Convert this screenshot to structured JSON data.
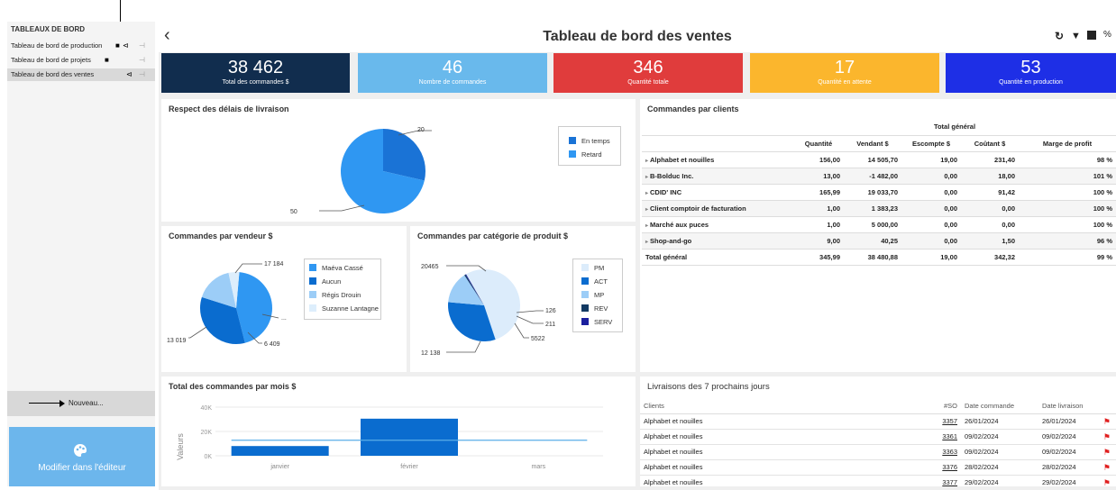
{
  "sidebar": {
    "title": "TABLEAUX DE BORD",
    "items": [
      {
        "label": "Tableau de bord de production"
      },
      {
        "label": "Tableau de bord de projets"
      },
      {
        "label": "Tableau de bord des ventes"
      }
    ],
    "new_label": "Nouveau...",
    "edit_label": "Modifier dans l'éditeur"
  },
  "header": {
    "title": "Tableau de bord des ventes"
  },
  "kpis": [
    {
      "value": "38 462",
      "label": "Total des commandes $",
      "color": "#112d4e"
    },
    {
      "value": "46",
      "label": "Nombre de commandes",
      "color": "#69b9ec"
    },
    {
      "value": "346",
      "label": "Quantité totale",
      "color": "#e03c3c"
    },
    {
      "value": "17",
      "label": "Quantité en attente",
      "color": "#fbb62d"
    },
    {
      "value": "53",
      "label": "Quantité en production",
      "color": "#1e2fe6"
    }
  ],
  "chart_data": [
    {
      "type": "pie",
      "title": "Respect des délais de livraison",
      "categories": [
        "En temps",
        "Retard"
      ],
      "values": [
        20,
        50
      ],
      "colors": [
        "#1a73d6",
        "#2f97f2"
      ],
      "legend": "right"
    },
    {
      "type": "pie",
      "title": "Commandes par vendeur $",
      "categories": [
        "Maéva Cassé",
        "Aucun",
        "Régis Drouin",
        "Suzanne Lantagne"
      ],
      "values": [
        17184,
        13019,
        6409,
        1850
      ],
      "data_labels": [
        "17 184",
        "13 019",
        "6 409",
        "..."
      ],
      "colors": [
        "#2f97f2",
        "#0a6ccf",
        "#9ccdf7",
        "#ddeefc"
      ],
      "legend": "right"
    },
    {
      "type": "pie",
      "title": "Commandes par catégorie de produit $",
      "categories": [
        "PM",
        "ACT",
        "MP",
        "REV",
        "SERV"
      ],
      "values": [
        20465,
        12138,
        5522,
        211,
        126
      ],
      "data_labels": [
        "20465",
        "12 138",
        "5522",
        "211",
        "126"
      ],
      "colors": [
        "#dcecfb",
        "#0a6ccf",
        "#9ccdf7",
        "#123a63",
        "#1b1f9e"
      ],
      "legend": "right"
    },
    {
      "type": "bar",
      "title": "Total des commandes par mois $",
      "categories": [
        "janvier",
        "février",
        "mars"
      ],
      "values": [
        8000,
        30500,
        0
      ],
      "average": 12800,
      "ylabel": "Valeurs",
      "yticks": [
        "40K",
        "20K",
        "0K"
      ],
      "ylim": [
        0,
        40000
      ]
    }
  ],
  "clients_table": {
    "title": "Commandes par clients",
    "group_header": "Total général",
    "columns": [
      "Quantité",
      "Vendant $",
      "Escompte $",
      "Coûtant $",
      "Marge de profit"
    ],
    "rows": [
      {
        "client": "Alphabet et nouilles",
        "cells": [
          "156,00",
          "14 505,70",
          "19,00",
          "231,40",
          "98 %"
        ]
      },
      {
        "client": "B-Bolduc Inc.",
        "cells": [
          "13,00",
          "-1 482,00",
          "0,00",
          "18,00",
          "101 %"
        ]
      },
      {
        "client": "CDID' INC",
        "cells": [
          "165,99",
          "19 033,70",
          "0,00",
          "91,42",
          "100 %"
        ]
      },
      {
        "client": "Client comptoir de facturation",
        "cells": [
          "1,00",
          "1 383,23",
          "0,00",
          "0,00",
          "100 %"
        ]
      },
      {
        "client": "Marché aux puces",
        "cells": [
          "1,00",
          "5 000,00",
          "0,00",
          "0,00",
          "100 %"
        ]
      },
      {
        "client": "Shop-and-go",
        "cells": [
          "9,00",
          "40,25",
          "0,00",
          "1,50",
          "96 %"
        ]
      }
    ],
    "total": {
      "client": "Total général",
      "cells": [
        "345,99",
        "38 480,88",
        "19,00",
        "342,32",
        "99 %"
      ]
    }
  },
  "deliveries": {
    "title": "Livraisons des 7 prochains jours",
    "columns": [
      "Clients",
      "#SO",
      "Date commande",
      "Date livraison"
    ],
    "rows": [
      {
        "client": "Alphabet et nouilles",
        "so": "3357",
        "order": "26/01/2024",
        "delivery": "26/01/2024"
      },
      {
        "client": "Alphabet et nouilles",
        "so": "3361",
        "order": "09/02/2024",
        "delivery": "09/02/2024"
      },
      {
        "client": "Alphabet et nouilles",
        "so": "3363",
        "order": "09/02/2024",
        "delivery": "09/02/2024"
      },
      {
        "client": "Alphabet et nouilles",
        "so": "3376",
        "order": "28/02/2024",
        "delivery": "28/02/2024"
      },
      {
        "client": "Alphabet et nouilles",
        "so": "3377",
        "order": "29/02/2024",
        "delivery": "29/02/2024"
      }
    ]
  }
}
